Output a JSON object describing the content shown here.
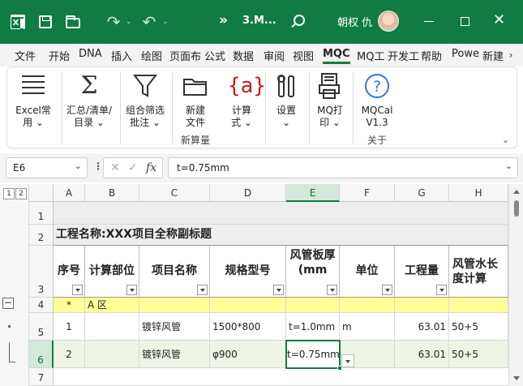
{
  "titlebar": {
    "more": "»",
    "doc_title": "3.M...",
    "user_name": "朝权 仇"
  },
  "tabs": [
    "文件",
    "开始",
    "DNA",
    "插入",
    "绘图",
    "页面布",
    "公式",
    "数据",
    "审阅",
    "视图",
    "MQC",
    "MQ工",
    "开发工",
    "帮助",
    "Powe",
    "新建"
  ],
  "active_tab": "MQC",
  "ribbon": {
    "buttons": [
      {
        "l1": "Excel常",
        "l2": "用 ⌄"
      },
      {
        "l1": "汇总/清单/",
        "l2": "目录 ⌄"
      },
      {
        "l1": "组合筛选",
        "l2": "批注 ⌄"
      },
      {
        "l1": "新建",
        "l2": "文件"
      },
      {
        "l1": "计算",
        "l2": "式 ⌄"
      },
      {
        "l1": "设置",
        "l2": "⌄"
      },
      {
        "l1": "MQ打",
        "l2": "印 ⌄"
      },
      {
        "l1": "MQCal",
        "l2": "V1.3"
      }
    ],
    "group_labels": [
      "新算量",
      "关于"
    ],
    "icon_brace_text": "{a}",
    "icon_help_text": "?"
  },
  "formula_bar": {
    "name_box": "E6",
    "dots": "⋮",
    "cancel": "✕",
    "confirm": "✓",
    "fx": "fx",
    "value": "t=0.75mm"
  },
  "sheet": {
    "outline_levels": [
      "1",
      "2"
    ],
    "outline_minus": "−",
    "columns": [
      "A",
      "B",
      "C",
      "D",
      "E",
      "F",
      "G",
      "H"
    ],
    "selected_column": "E",
    "rows": [
      "1",
      "2",
      "3",
      "4",
      "5",
      "6",
      "7"
    ],
    "selected_row": "6",
    "title_cell": "工程名称:XXX项目全称副标题",
    "headers": [
      "序号",
      "计算部位",
      "项目名称",
      "规格型号",
      "风管板厚(mm",
      "单位",
      "工程量",
      "风管水长度计算"
    ],
    "row4": {
      "a": "*",
      "b": "A 区"
    },
    "row5": {
      "a": "1",
      "c": "镀锌风管",
      "d": "1500*800",
      "e": "t=1.0mm",
      "f": "m",
      "g": "63.01",
      "h": "50+5"
    },
    "row6": {
      "a": "2",
      "c": "镀锌风管",
      "d": "φ900",
      "e": "t=0.75mm",
      "g": "63.01",
      "h": "50+5"
    }
  },
  "colors": {
    "accent": "#107c41",
    "row4_fill": "#ffff99",
    "row6_fill": "#eef5e6"
  },
  "icons": [
    "excel-logo-icon",
    "save-icon",
    "open-folder-icon",
    "redo-icon",
    "undo-icon",
    "search-icon",
    "minimize-icon",
    "maximize-icon",
    "close-icon"
  ]
}
